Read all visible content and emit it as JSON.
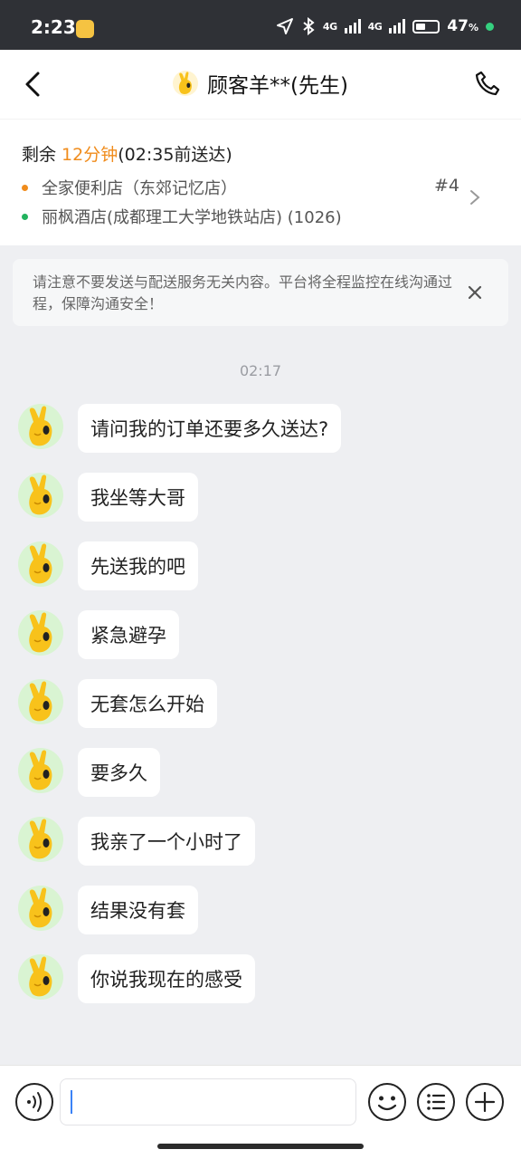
{
  "status_bar": {
    "time": "2:23",
    "signal1": "4G",
    "signal2": "4G",
    "battery": "47"
  },
  "header": {
    "title": "顾客羊**(先生)"
  },
  "order": {
    "remain_prefix": "剩余 ",
    "remain_minutes": "12分钟",
    "remain_suffix": "(02:35前送达)",
    "from_store": "全家便利店（东郊记忆店）",
    "to_address": "丽枫酒店(成都理工大学地铁站店) (1026)",
    "order_number": "#4",
    "from_dot_color": "#f08c1c",
    "to_dot_color": "#22b35e"
  },
  "notice": {
    "text": "请注意不要发送与配送服务无关内容。平台将全程监控在线沟通过程，保障沟通安全！"
  },
  "chat": {
    "time": "02:17",
    "messages": [
      {
        "text": "请问我的订单还要多久送达?"
      },
      {
        "text": "我坐等大哥"
      },
      {
        "text": "先送我的吧"
      },
      {
        "text": "紧急避孕"
      },
      {
        "text": "无套怎么开始"
      },
      {
        "text": "要多久"
      },
      {
        "text": "我亲了一个小时了"
      },
      {
        "text": "结果没有套"
      },
      {
        "text": "你说我现在的感受"
      }
    ]
  },
  "input": {
    "value": ""
  },
  "icons": {
    "back": "chevron-left-icon",
    "call": "phone-icon",
    "voice": "voice-icon",
    "emoji": "emoji-icon",
    "menu": "list-icon",
    "add": "plus-icon"
  }
}
